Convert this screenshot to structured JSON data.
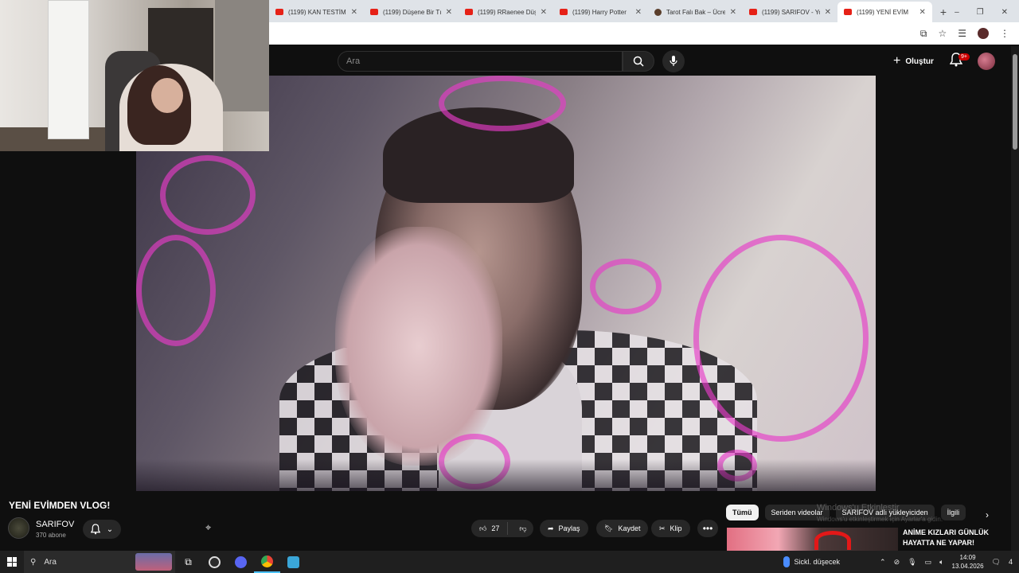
{
  "browser": {
    "tabs": [
      {
        "label": "(1199) KAN TESTİM",
        "icon": "youtube-icon"
      },
      {
        "label": "(1199) Düşene Bir Tı",
        "icon": "youtube-icon"
      },
      {
        "label": "(1199) RRaenee Düş",
        "icon": "youtube-icon"
      },
      {
        "label": "(1199) Harry Potter",
        "icon": "youtube-icon"
      },
      {
        "label": "Tarot Falı Bak – Ücre",
        "icon": "tarot-icon"
      },
      {
        "label": "(1199) SARIFOV - Yo",
        "icon": "youtube-icon"
      },
      {
        "label": "(1199) YENİ EVİM",
        "icon": "youtube-icon",
        "active": true
      }
    ],
    "new_tab": "+",
    "window_controls": [
      "–",
      "❐",
      "✕"
    ]
  },
  "youtube": {
    "search_placeholder": "Ara",
    "create_label": "Oluştur",
    "notif_badge": "9+",
    "video_title": "YENİ EVİMDEN VLOG!",
    "channel_name": "SARIFOV",
    "subscribers": "370 abone",
    "like_count": "27",
    "share_label": "Paylaş",
    "save_label": "Kaydet",
    "clip_label": "Klip",
    "more_label": "•••",
    "chips": [
      "Tümü",
      "Seriden videolar",
      "SARIFOV adlı yükleyiciden",
      "İlgili"
    ],
    "watermark_line1": "Windows'u Etkinleştir",
    "watermark_line2": "Windows'u etkinleştirmek için Ayarlar'a gidin.",
    "recommended_title": "ANİME KIZLARI GÜNLÜK HAYATTA NE YAPAR!"
  },
  "taskbar": {
    "search_label": "Ara",
    "weather": "Sickl. düşecek",
    "time": "14:09",
    "date": "13.04.2026",
    "notif_count": "4"
  },
  "colors": {
    "youtube_bg": "#0f0f0f",
    "accent_red": "#cc0000",
    "button_bg": "#272727",
    "taskbar_bg": "#1f1f1f"
  }
}
